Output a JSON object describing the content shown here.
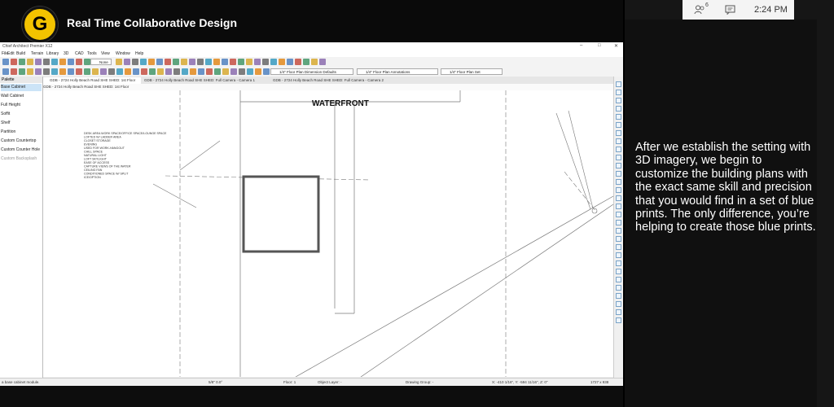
{
  "meeting": {
    "title": "Real Time Collaborative Design",
    "logo_letter": "G",
    "logo_color": "#f3c300"
  },
  "teams_bar": {
    "participants_badge": "6",
    "time": "2:24 PM"
  },
  "caption": "After we establish the setting with 3D imagery, we begin to customize the building plans with the exact same skill and precision that you would find in a set of blue prints. The only difference, you’re helping to create those blue prints.",
  "cad": {
    "window_title": "Chief Architect Premier X12",
    "window_controls": [
      "–",
      "□",
      "✕"
    ],
    "menu": [
      "File",
      "Edit",
      "Build",
      "Terrain",
      "Library",
      "3D",
      "CAD",
      "Tools",
      "View",
      "Window",
      "Help"
    ],
    "toolbar_combos": [
      {
        "label": "None"
      },
      {
        "label": "1/4\" Floor Plan Dimension Defaults"
      },
      {
        "label": "1/4\" Floor Plan Annotations"
      },
      {
        "label": "1/4\" Floor Plan Set"
      }
    ],
    "palette_title": "Palette",
    "palette_items": [
      "Base Cabinet",
      "Wall Cabinet",
      "Full Height",
      "Soffit",
      "Shelf",
      "Partition",
      "Custom Countertop",
      "Custom Counter Hole",
      "Custom Backsplash"
    ],
    "tabs": [
      "GDB - 2724 Holly Beach Road SHE SHED: 1st Floor",
      "GDB - 2724 Holly Beach Road SHE SHED: Full Camera - Camera 1",
      "GDB - 2724 Holly Beach Road SHE SHED: Full Camera - Camera 2"
    ],
    "active_view": "GDB - 2724 Holly Beach Road SHE SHED: 1st Floor",
    "plan_heading": "WATERFRONT",
    "notes": [
      "DESK AREA WORK SPACE/OFFICE SPACE/LOUNGE SPACE",
      "LOFTED W/ LADDER AREA",
      "CLOSET STORAGE",
      "EVENING",
      "USED FOR WORK-HANGOUT",
      "CHILL SPACE",
      "NATURAL LIGHT",
      "LOFT SKYLIGHT",
      "EASE OF ACCESS",
      "CAPTURE VIEWS OF THE WATER",
      "CEILING FAN",
      "CONDITIONED SPACE W/ SPLIT",
      "ICE/OPTION"
    ],
    "status": {
      "hint": "a base cabinet module.",
      "angle": "5/8\"   0.0°",
      "floor": "Floor: 1",
      "object_layer": "Object Layer: -",
      "drawing_group": "Drawing Group: -",
      "coords": "X: -410 1/16\", Y: -594 11/16\", Z: 0\"",
      "size": "1727 x 938"
    }
  }
}
